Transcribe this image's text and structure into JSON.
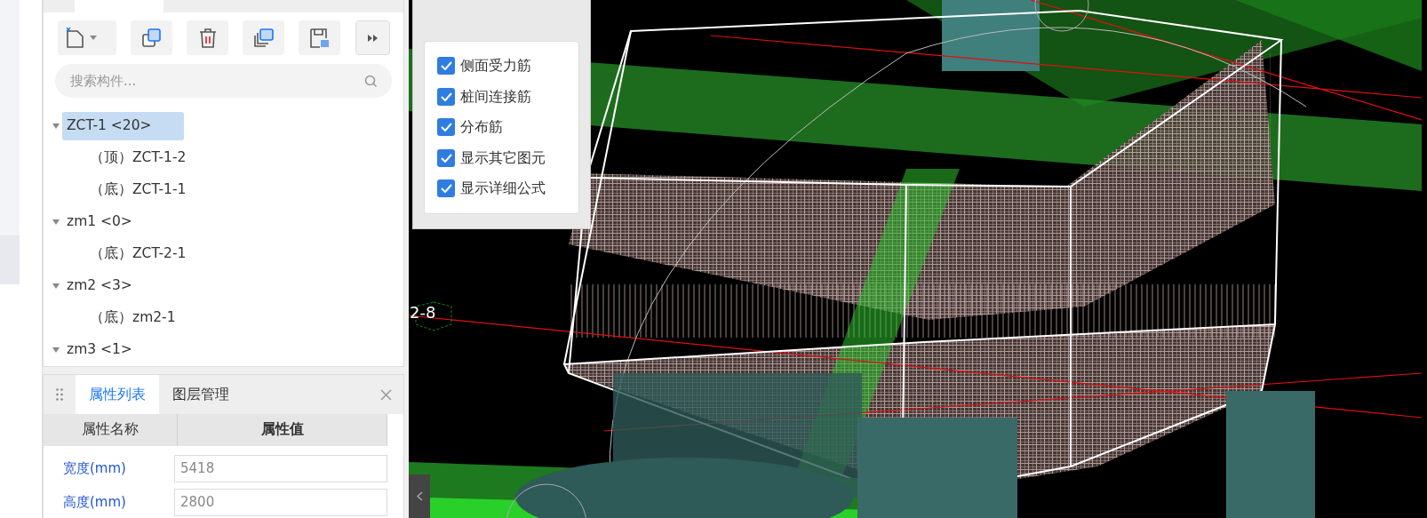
{
  "tree_panel": {
    "search": {
      "placeholder": "搜索构件..."
    },
    "tree": [
      {
        "label": "ZCT-1 <20>",
        "selected": true,
        "expanded": true,
        "children": [
          {
            "label": "（顶）ZCT-1-2",
            "selected": false
          },
          {
            "label": "（底）ZCT-1-1",
            "selected": false
          }
        ]
      },
      {
        "label": "zm1 <0>",
        "selected": false,
        "expanded": true,
        "children": [
          {
            "label": "（底）ZCT-2-1",
            "selected": false
          }
        ]
      },
      {
        "label": "zm2 <3>",
        "selected": false,
        "expanded": true,
        "children": [
          {
            "label": "（底）zm2-1",
            "selected": false
          }
        ]
      },
      {
        "label": "zm3 <1>",
        "selected": false,
        "expanded": true
      }
    ]
  },
  "properties_panel": {
    "tabs": [
      {
        "label": "属性列表",
        "selected": true
      },
      {
        "label": "图层管理",
        "selected": false
      }
    ],
    "columns": [
      "属性名称",
      "属性值"
    ],
    "rows": [
      {
        "name": "宽度(mm)",
        "value": "5418"
      },
      {
        "name": "高度(mm)",
        "value": "2800"
      }
    ]
  },
  "rebar_panel": {
    "options": [
      {
        "label": "侧面受力筋",
        "checked": true
      },
      {
        "label": "桩间连接筋",
        "checked": true
      },
      {
        "label": "分布筋",
        "checked": true
      },
      {
        "label": "显示其它图元",
        "checked": true
      },
      {
        "label": "显示详细公式",
        "checked": true
      }
    ]
  },
  "viewport": {
    "axis_label": "2-8"
  }
}
